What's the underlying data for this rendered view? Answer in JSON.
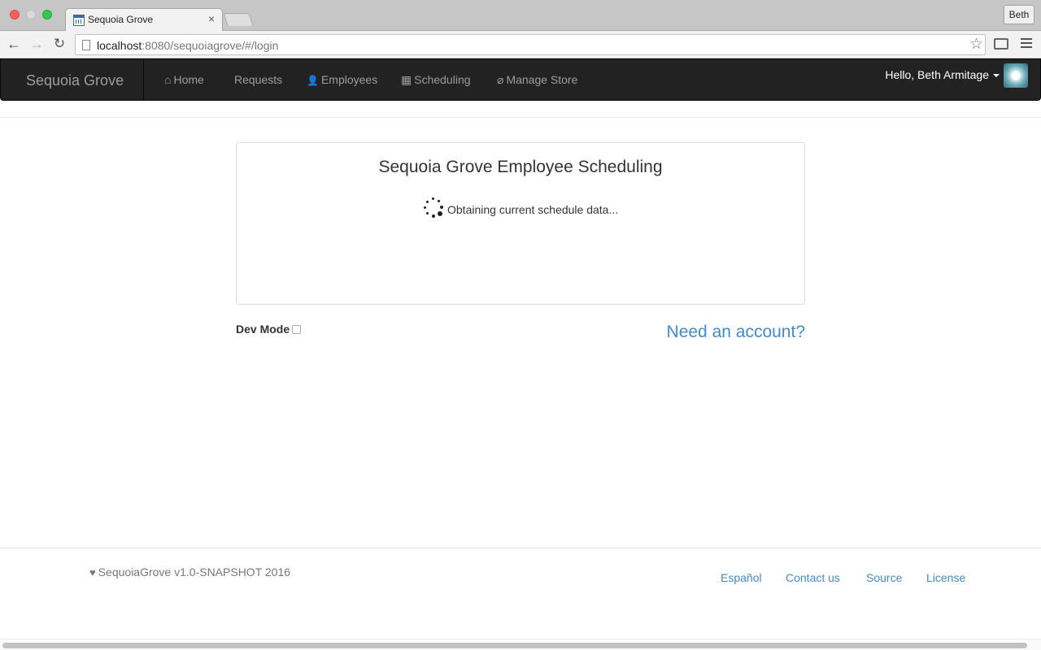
{
  "browser": {
    "tab_title": "Sequoia Grove",
    "tab_close": "×",
    "profile_name": "Beth",
    "url_host": "localhost",
    "url_path": ":8080/sequoiagrove/#/login",
    "back_glyph": "←",
    "forward_glyph": "→",
    "reload_glyph": "↻",
    "star_glyph": "☆"
  },
  "navbar": {
    "brand": "Sequoia Grove",
    "links": [
      {
        "label": "Home",
        "icon": "home-icon",
        "glyph": "⌂"
      },
      {
        "label": "Requests"
      },
      {
        "label": "Employees",
        "icon": "user-icon",
        "glyph": "👤"
      },
      {
        "label": "Scheduling",
        "icon": "calendar-icon",
        "glyph": "▦"
      },
      {
        "label": "Manage Store",
        "icon": "paperclip-icon",
        "glyph": "⌀"
      }
    ],
    "user_greeting": "Hello, Beth Armitage"
  },
  "panel": {
    "title": "Sequoia Grove Employee Scheduling",
    "loading_text": "Obtaining current schedule data..."
  },
  "devmode": {
    "label": "Dev Mode",
    "checked": false
  },
  "need_account": "Need an account?",
  "footer": {
    "heart_glyph": "♥",
    "copyright": "SequoiaGrove v1.0-SNAPSHOT 2016",
    "links": [
      "Español",
      "Contact us",
      "Source",
      "License"
    ]
  },
  "colors": {
    "navbar_bg": "#222222",
    "link": "#428bca",
    "nav_text": "#9d9d9d"
  }
}
